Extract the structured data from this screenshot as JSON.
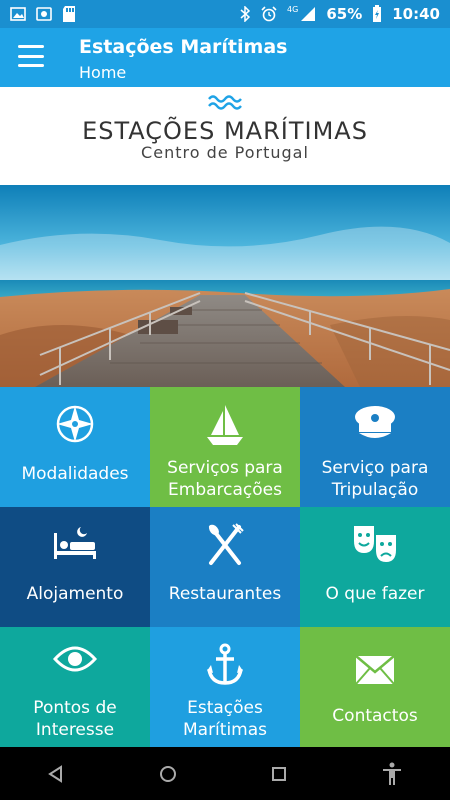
{
  "status_bar": {
    "battery": "65%",
    "time": "10:40",
    "network": "4G"
  },
  "app_bar": {
    "title": "Estações Marítimas",
    "subtitle": "Home"
  },
  "logo": {
    "main": "ESTAÇÕES MARÍTIMAS",
    "sub": "Centro de Portugal"
  },
  "tiles": [
    {
      "label": "Modalidades",
      "icon": "compass-icon",
      "color": "#1f9fe0"
    },
    {
      "label": "Serviços para\nEmbarcações",
      "icon": "sailboat-icon",
      "color": "#6fbe45"
    },
    {
      "label": "Serviço para\nTripulação",
      "icon": "captain-hat-icon",
      "color": "#1b7fc4"
    },
    {
      "label": "Alojamento",
      "icon": "bed-icon",
      "color": "#0f4c84"
    },
    {
      "label": "Restaurantes",
      "icon": "fork-knife-icon",
      "color": "#1b7fc4"
    },
    {
      "label": "O que fazer",
      "icon": "theater-masks-icon",
      "color": "#0ea89d"
    },
    {
      "label": "Pontos de\nInteresse",
      "icon": "eye-icon",
      "color": "#0ea89d"
    },
    {
      "label": "Estações\nMarítimas",
      "icon": "anchor-icon",
      "color": "#1f9fe0"
    },
    {
      "label": "Contactos",
      "icon": "envelope-icon",
      "color": "#6fbe45"
    }
  ],
  "colors": {
    "status_bar": "#1a8fd0",
    "app_bar": "#1fa3e6"
  }
}
